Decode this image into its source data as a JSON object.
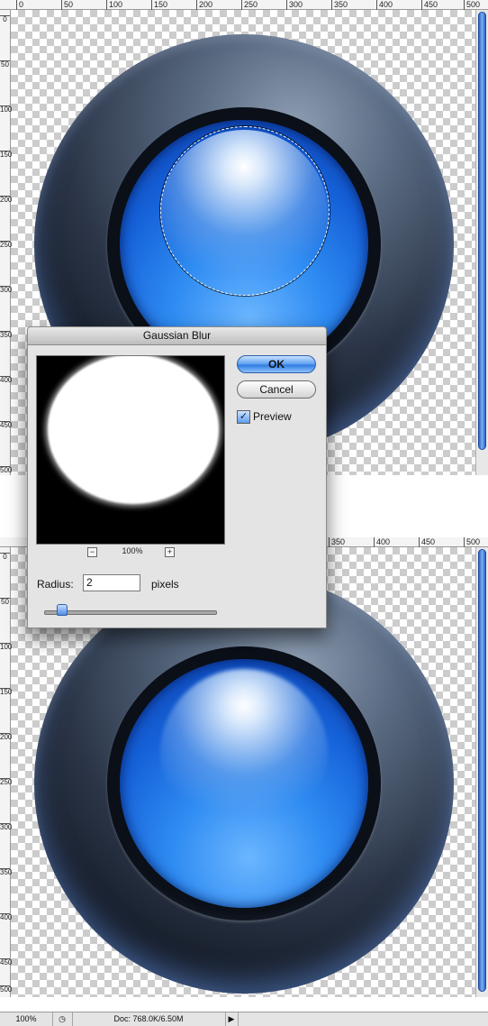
{
  "rulers": {
    "horizontal_top": [
      "0",
      "50",
      "100",
      "150",
      "200",
      "250",
      "300",
      "350",
      "400",
      "450",
      "500"
    ],
    "horizontal_bottom": [
      "350",
      "400",
      "450",
      "500"
    ],
    "vertical_top": [
      "0",
      "50",
      "100",
      "150",
      "200",
      "250",
      "300",
      "350",
      "400",
      "450",
      "500"
    ],
    "vertical_bottom": [
      "0",
      "50",
      "100",
      "150",
      "200",
      "250",
      "300",
      "350",
      "400",
      "450",
      "500"
    ]
  },
  "dialog": {
    "title": "Gaussian Blur",
    "ok_label": "OK",
    "cancel_label": "Cancel",
    "preview_label": "Preview",
    "preview_checked": true,
    "zoom_out": "−",
    "zoom_in": "+",
    "zoom_level": "100%",
    "radius_label": "Radius:",
    "radius_value": "2",
    "radius_unit": "pixels",
    "radius_slider_fraction": 0.1
  },
  "status_bar": {
    "zoom": "100%",
    "doc_info": "Doc: 768.0K/6.50M"
  },
  "colors": {
    "orb_blue": "#2f8cf2",
    "button_blue": "#5b9ef0",
    "scroll_blue": "#2a63c9"
  },
  "icons": {
    "checkbox": "check-icon",
    "status_menu": "triangle-right-icon",
    "status_nav": "navigator-icon"
  }
}
